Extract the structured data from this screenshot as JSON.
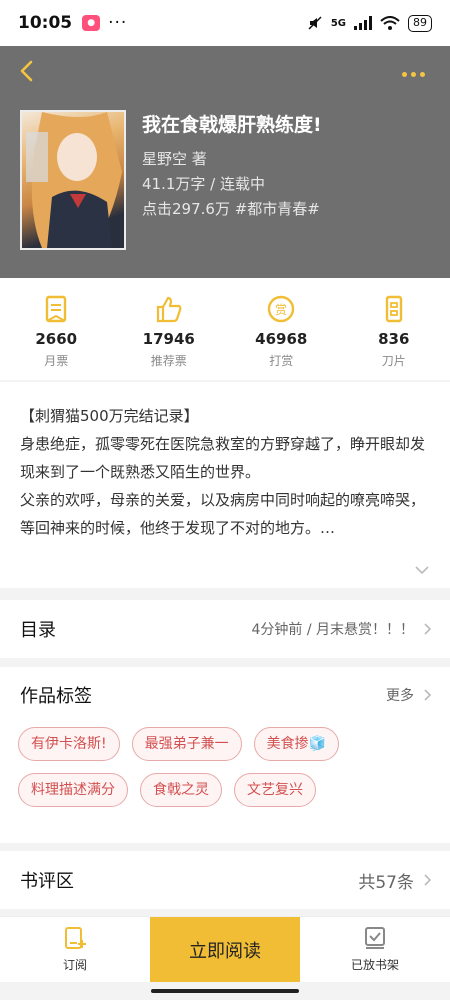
{
  "status_bar": {
    "time": "10:05",
    "more": "···",
    "network": "5G",
    "battery": "89"
  },
  "book": {
    "title": "我在食戟爆肝熟练度!",
    "author": "星野空 著",
    "words_status": "41.1万字 / 连载中",
    "clicks_tags": "点击297.6万 #都市青春#"
  },
  "stats": [
    {
      "value": "2660",
      "label": "月票",
      "icon": "ticket-icon"
    },
    {
      "value": "17946",
      "label": "推荐票",
      "icon": "thumbs-up-icon"
    },
    {
      "value": "46968",
      "label": "打赏",
      "icon": "reward-coin-icon"
    },
    {
      "value": "836",
      "label": "刀片",
      "icon": "blade-icon"
    }
  ],
  "intro": {
    "line1": "【刺猬猫500万完结记录】",
    "line2": "身患绝症，孤零零死在医院急救室的方野穿越了，睁开眼却发现来到了一个既熟悉又陌生的世界。",
    "line3": "父亲的欢呼，母亲的关爱，以及病房中同时响起的嘹亮啼哭，等回神来的时候，他终于发现了不对的地方。…"
  },
  "catalog": {
    "title": "目录",
    "latest": "4分钟前 / 月末悬赏！！！"
  },
  "tags_section": {
    "title": "作品标签",
    "more": "更多",
    "tags": [
      "有伊卡洛斯!",
      "最强弟子兼一",
      "美食掺🧊",
      "料理描述满分",
      "食戟之灵",
      "文艺复兴"
    ]
  },
  "reviews": {
    "title": "书评区",
    "count": "共57条"
  },
  "bottom_bar": {
    "subscribe": "订阅",
    "read_now": "立即阅读",
    "on_shelf": "已放书架"
  },
  "colors": {
    "accent": "#f0bd35",
    "header_bg": "#6f6f6f",
    "tag_text": "#d35050"
  }
}
